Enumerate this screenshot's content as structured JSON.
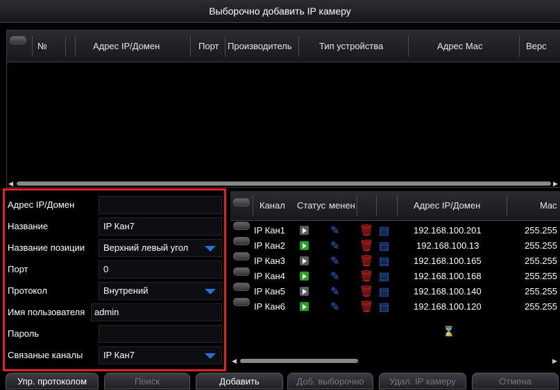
{
  "title": "Выборочно добавить IP камеру",
  "search_table": {
    "columns": [
      "№",
      "Адрес IP/Домен",
      "Порт",
      "Производитель",
      "Тип устройства",
      "Адрес Мас",
      "Верс"
    ]
  },
  "form": {
    "ip_label": "Адрес IP/Домен",
    "ip_value": "",
    "name_label": "Название",
    "name_value": "IP Кан7",
    "position_label": "Название позиции",
    "position_value": "Верхний левый угол",
    "port_label": "Порт",
    "port_value": "0",
    "protocol_label": "Протокол",
    "protocol_value": "Внутрений",
    "user_label": "Имя пользователя",
    "user_value": "admin",
    "password_label": "Пароль",
    "password_value": "",
    "channel_label": "Связаные каналы",
    "channel_value": "IP Кан7"
  },
  "channel_table": {
    "columns": [
      "Канал",
      "Статус",
      "менен",
      "Адрес IP/Домен",
      "Mac"
    ],
    "rows": [
      {
        "channel": "IP Кан1",
        "status": "offline",
        "ip": "192.168.100.201",
        "mask": "255.255"
      },
      {
        "channel": "IP Кан2",
        "status": "online",
        "ip": "192.168.100.13",
        "mask": "255.255"
      },
      {
        "channel": "IP Кан3",
        "status": "offline",
        "ip": "192.168.100.165",
        "mask": "255.255"
      },
      {
        "channel": "IP Кан4",
        "status": "online",
        "ip": "192.168.100.168",
        "mask": "255.255"
      },
      {
        "channel": "IP Кан5",
        "status": "offline",
        "ip": "192.168.100.140",
        "mask": "255.255"
      },
      {
        "channel": "IP Кан6",
        "status": "online",
        "ip": "192.168.100.120",
        "mask": "255.255"
      }
    ]
  },
  "buttons": {
    "protocol": "Упр. протоколом",
    "search": "Поиск",
    "add": "Добавить",
    "batch_add": "Доб. выборочно",
    "delete": "Удал. IP камеру",
    "cancel": "Отмена"
  },
  "colors": {
    "online": "#1fa31f",
    "offline": "#5a5d62",
    "accent": "#2a6de0",
    "highlight": "#e3201f"
  }
}
